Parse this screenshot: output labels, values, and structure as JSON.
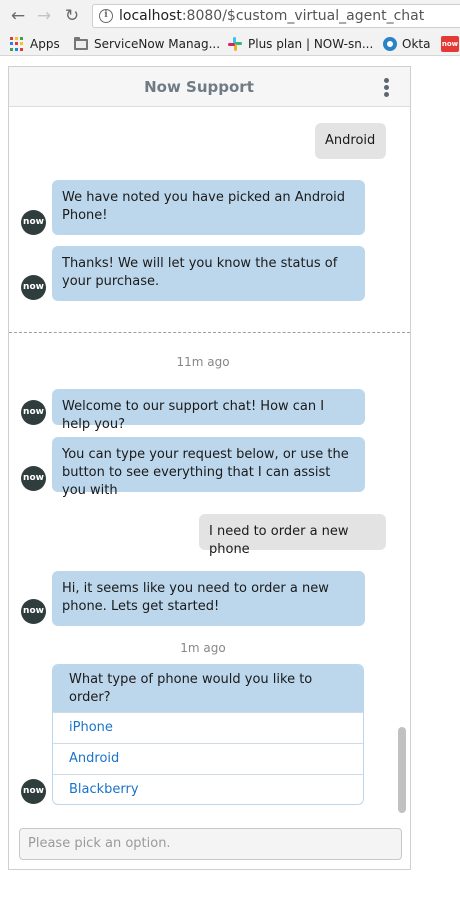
{
  "browser": {
    "url_host": "localhost",
    "url_rest": ":8080/$custom_virtual_agent_chat",
    "bookmarks": [
      {
        "label": "Apps"
      },
      {
        "label": "ServiceNow Manag..."
      },
      {
        "label": "Plus plan | NOW-sn..."
      },
      {
        "label": "Okta"
      }
    ],
    "now_badge": "now"
  },
  "chat": {
    "title": "Now Support",
    "avatar_label": "now",
    "messages": [
      {
        "from": "user",
        "text": "Android"
      },
      {
        "from": "bot",
        "text": "We have noted you have picked an Android Phone!"
      },
      {
        "from": "bot",
        "text": "Thanks! We will let you know the status of your purchase."
      },
      {
        "from": "bot",
        "text": "Welcome to our support chat! How can I help you?"
      },
      {
        "from": "bot",
        "text": "You can type your request below, or use the button to see everything that I can assist you with"
      },
      {
        "from": "user",
        "text": "I need to order a new phone"
      },
      {
        "from": "bot",
        "text": "Hi, it seems like you need to order a new phone. Lets get started!"
      }
    ],
    "timestamps": [
      "11m ago",
      "1m ago"
    ],
    "question": "What type of phone would you like to order?",
    "options": [
      "iPhone",
      "Android",
      "Blackberry"
    ],
    "input_placeholder": "Please pick an option."
  },
  "colors": {
    "bot_bubble": "#bcd7ec",
    "user_bubble": "#e3e3e3",
    "option_link": "#1a73c9",
    "avatar_bg": "#2f3d3c"
  }
}
